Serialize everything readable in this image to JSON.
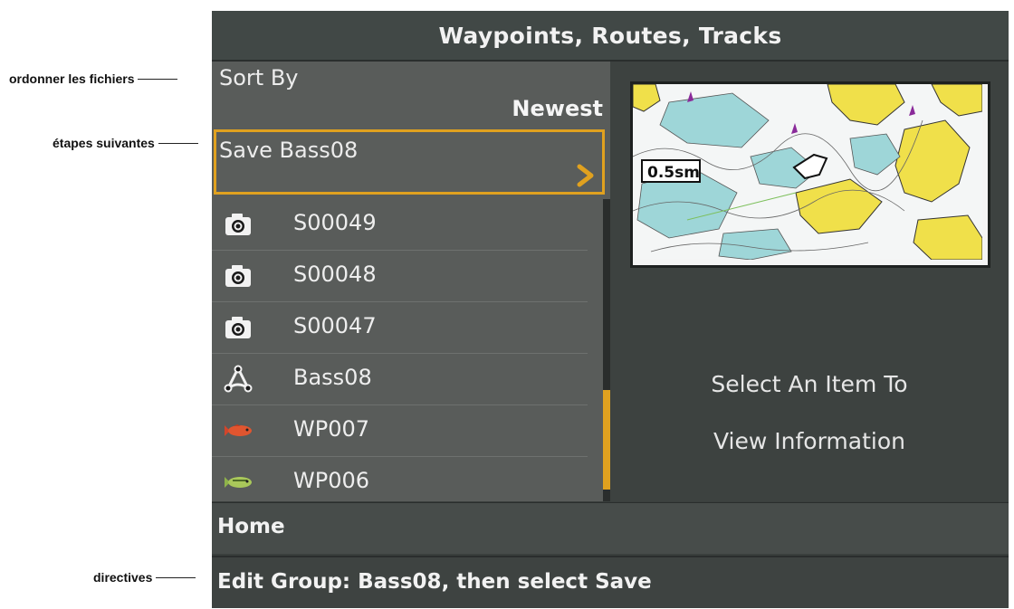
{
  "annotations": {
    "sort_callout": "ordonner les fichiers",
    "steps_callout": "étapes suivantes",
    "directives_callout": "directives"
  },
  "title": "Waypoints, Routes, Tracks",
  "sort": {
    "label": "Sort By",
    "value": "Newest"
  },
  "save_item": {
    "label": "Save Bass08",
    "chevron_icon": "chevron-right-icon"
  },
  "items": [
    {
      "name": "S00049",
      "icon": "camera-icon"
    },
    {
      "name": "S00048",
      "icon": "camera-icon"
    },
    {
      "name": "S00047",
      "icon": "camera-icon"
    },
    {
      "name": "Bass08",
      "icon": "route-group-icon"
    },
    {
      "name": "WP007",
      "icon": "red-fish-icon"
    },
    {
      "name": "WP006",
      "icon": "green-fish-icon"
    }
  ],
  "map": {
    "scale": "0.5sm"
  },
  "info": {
    "line1": "Select An Item To",
    "line2": "View Information"
  },
  "home": "Home",
  "directive": "Edit Group: Bass08, then select Save",
  "colors": {
    "accent": "#e0a11f",
    "panel": "#595c5a",
    "background": "#3a3f3d",
    "land": "#f2e24c"
  }
}
